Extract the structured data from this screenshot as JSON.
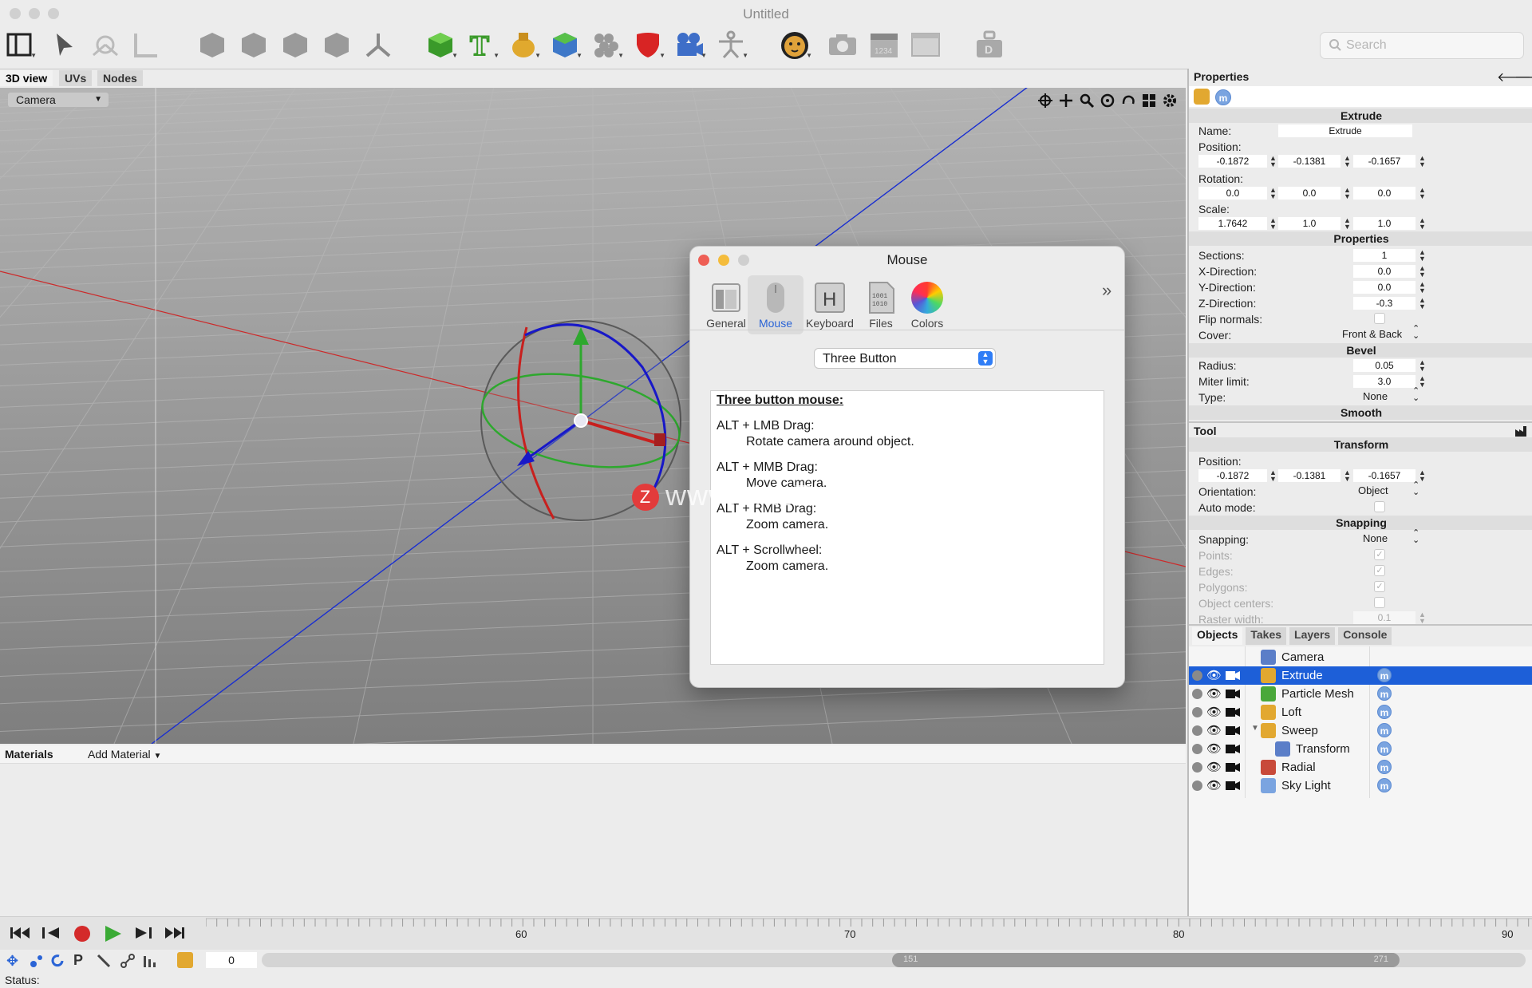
{
  "window": {
    "title": "Untitled"
  },
  "toolbar": {
    "icons": [
      "view-layout-icon",
      "select-arrow-icon",
      "transform-gizmo-icon",
      "ruler-icon",
      "cube-gray-1-icon",
      "cube-gray-2-icon",
      "cube-gray-3-icon",
      "cube-gray-4-icon",
      "axis-icon",
      "cube-green-icon",
      "text-icon",
      "lathe-vase-icon",
      "extrude-cube-icon",
      "particle-icon",
      "shield-icon",
      "camera-object-icon",
      "figure-icon",
      "cheetah-render-icon",
      "snapshot-camera-icon",
      "clapperboard-icon",
      "window-icon",
      "weight-icon"
    ],
    "search_placeholder": "Search"
  },
  "view_tabs": [
    "3D view",
    "UVs",
    "Nodes"
  ],
  "viewport": {
    "camera_label": "Camera",
    "nav_icons": [
      "move-view-icon",
      "pan-icon",
      "zoom-icon",
      "orbit-icon",
      "undo-view-icon",
      "grid-layout-icon",
      "gear-icon"
    ]
  },
  "materials": {
    "label": "Materials",
    "add_label": "Add Material"
  },
  "watermark": "www.MacZ.com",
  "properties": {
    "header": "Properties",
    "section_extrude": "Extrude",
    "name_label": "Name:",
    "name_value": "Extrude",
    "position_label": "Position:",
    "position": [
      "-0.1872",
      "-0.1381",
      "-0.1657"
    ],
    "rotation_label": "Rotation:",
    "rotation": [
      "0.0",
      "0.0",
      "0.0"
    ],
    "scale_label": "Scale:",
    "scale": [
      "1.7642",
      "1.0",
      "1.0"
    ],
    "section_properties": "Properties",
    "sections_label": "Sections:",
    "sections_value": "1",
    "xdir_label": "X-Direction:",
    "xdir_value": "0.0",
    "ydir_label": "Y-Direction:",
    "ydir_value": "0.0",
    "zdir_label": "Z-Direction:",
    "zdir_value": "-0.3",
    "flip_label": "Flip normals:",
    "cover_label": "Cover:",
    "cover_value": "Front & Back",
    "section_bevel": "Bevel",
    "radius_label": "Radius:",
    "radius_value": "0.05",
    "miter_label": "Miter limit:",
    "miter_value": "3.0",
    "type_label": "Type:",
    "type_value": "None",
    "section_smooth": "Smooth"
  },
  "tool": {
    "header": "Tool",
    "section_transform": "Transform",
    "position_label": "Position:",
    "position": [
      "-0.1872",
      "-0.1381",
      "-0.1657"
    ],
    "orientation_label": "Orientation:",
    "orientation_value": "Object",
    "auto_label": "Auto mode:",
    "section_snapping": "Snapping",
    "snapping_label": "Snapping:",
    "snapping_value": "None",
    "points_label": "Points:",
    "edges_label": "Edges:",
    "polygons_label": "Polygons:",
    "centers_label": "Object centers:",
    "raster_label": "Raster width:",
    "raster_value": "0.1"
  },
  "objects": {
    "tabs": [
      "Objects",
      "Takes",
      "Layers",
      "Console"
    ],
    "items": [
      {
        "name": "Camera",
        "indent": 0,
        "selected": false,
        "controls": false
      },
      {
        "name": "Extrude",
        "indent": 0,
        "selected": true,
        "controls": true
      },
      {
        "name": "Particle Mesh",
        "indent": 0,
        "selected": false,
        "controls": true
      },
      {
        "name": "Loft",
        "indent": 0,
        "selected": false,
        "controls": true
      },
      {
        "name": "Sweep",
        "indent": 0,
        "selected": false,
        "controls": true
      },
      {
        "name": "Transform",
        "indent": 1,
        "selected": false,
        "controls": true
      },
      {
        "name": "Radial",
        "indent": 0,
        "selected": false,
        "controls": true
      },
      {
        "name": "Sky Light",
        "indent": 0,
        "selected": false,
        "controls": true
      }
    ],
    "badge": "m"
  },
  "timeline": {
    "markers": [
      "60",
      "70",
      "80",
      "90"
    ],
    "frame_value": "0",
    "range_start": "151",
    "range_end": "271"
  },
  "status": {
    "label": "Status:"
  },
  "dialog": {
    "title": "Mouse",
    "tabs": [
      "General",
      "Mouse",
      "Keyboard",
      "Files",
      "Colors"
    ],
    "active_tab": "Mouse",
    "popup_value": "Three Button",
    "help_title": "Three button mouse:",
    "help": [
      {
        "key": "ALT + LMB Drag:",
        "desc": "Rotate camera around object."
      },
      {
        "key": "ALT + MMB Drag:",
        "desc": "Move camera."
      },
      {
        "key": "ALT + RMB Drag:",
        "desc": "Zoom camera."
      },
      {
        "key": "ALT + Scrollwheel:",
        "desc": "Zoom camera."
      }
    ]
  },
  "colors": {
    "selection": "#1d5fd8",
    "active_tab": "#2a64d6",
    "close": "#ee5e55",
    "minimize": "#f4bc3c",
    "play": "#3aaa35",
    "record": "#d42a2a"
  }
}
